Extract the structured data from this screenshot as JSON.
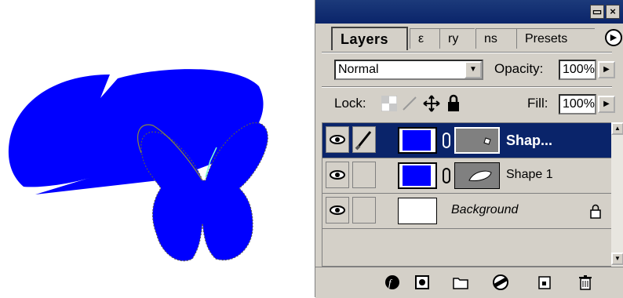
{
  "layers_panel": {
    "tabs": [
      {
        "label": "Layers",
        "active": true
      },
      {
        "label": "ry",
        "active": false
      },
      {
        "label": "ns",
        "active": false
      },
      {
        "label": "Presets",
        "active": false
      }
    ],
    "tab_partial_0": "ε",
    "blend_mode": "Normal",
    "opacity_label": "Opacity:",
    "opacity_value": "100%",
    "lock_label": "Lock:",
    "fill_label": "Fill:",
    "fill_value": "100%",
    "layers": [
      {
        "name": "Shap...",
        "selected": true,
        "visible": true
      },
      {
        "name": "Shape 1",
        "selected": false,
        "visible": true
      },
      {
        "name": "Background",
        "selected": false,
        "visible": true,
        "locked": true
      }
    ]
  },
  "colors": {
    "shape_fill": "#0000ff",
    "panel_bg": "#d4d0c8",
    "title_bar": "#0a246a",
    "selection": "#0a246a"
  },
  "icons": [
    "eye-icon",
    "brush-icon",
    "link-icon",
    "lock-icon",
    "move-icon",
    "transparency-lock-icon",
    "layer-style-icon",
    "mask-icon",
    "folder-icon",
    "adjustment-layer-icon",
    "new-layer-icon",
    "trash-icon",
    "minimize-icon",
    "close-icon",
    "palette-menu-icon"
  ]
}
